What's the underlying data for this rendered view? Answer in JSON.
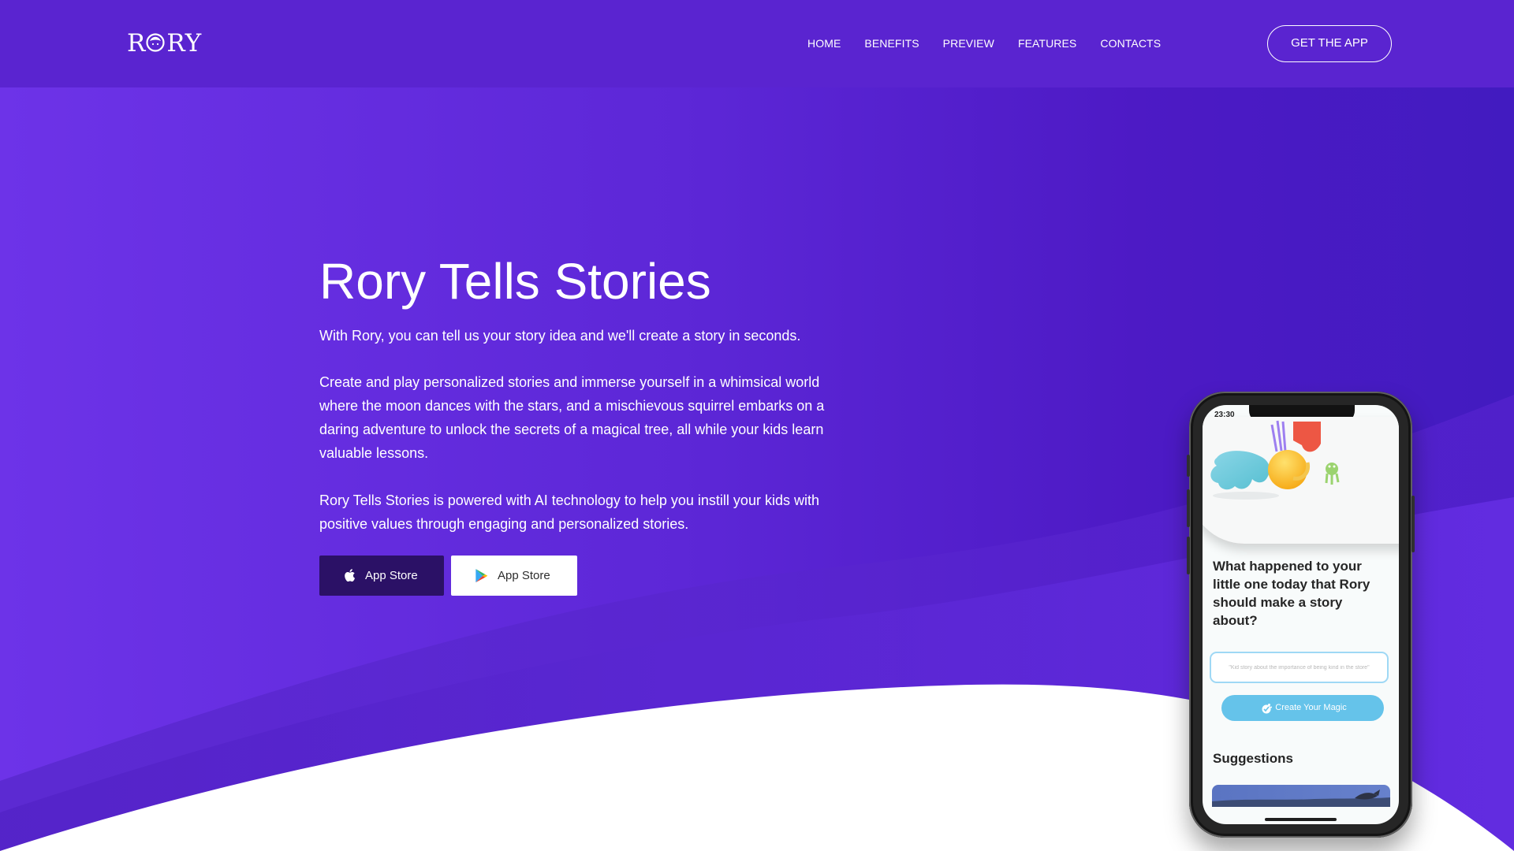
{
  "brand": {
    "logo_text": "RORY",
    "logo_icon": "rory-face-icon"
  },
  "nav": {
    "items": [
      {
        "label": "HOME"
      },
      {
        "label": "BENEFITS"
      },
      {
        "label": "PREVIEW"
      },
      {
        "label": "FEATURES"
      },
      {
        "label": "CONTACTS"
      }
    ],
    "cta_label": "GET THE APP"
  },
  "hero": {
    "title": "Rory Tells Stories",
    "subtitle": "With Rory, you can tell us your story idea and we'll create a story in seconds.",
    "paragraph_1": "Create and play personalized stories and immerse yourself in a whimsical world where the moon dances with the stars, and a mischievous squirrel embarks on a daring adventure to unlock the secrets of a magical tree, all while your kids learn valuable lessons.",
    "paragraph_2": "Rory Tells Stories is powered with AI technology to help you instill your kids with positive values through engaging and personalized stories."
  },
  "store_buttons": {
    "apple": {
      "label": "App Store",
      "icon": "apple-icon"
    },
    "google_play": {
      "label": "App Store",
      "icon": "google-play-icon"
    }
  },
  "phone": {
    "status_time": "23:30",
    "question": "What happened to your little one today that Rory should make a story about?",
    "input_placeholder": "\"Kid story about the importance of being kind in the store\"",
    "create_button_label": "Create Your Magic",
    "create_button_icon": "magic-sparkle-icon",
    "suggestions_title": "Suggestions"
  },
  "colors": {
    "header": "#5a24d0",
    "hero_start": "#6d33e8",
    "hero_end": "#421bc0",
    "apple_button": "#2b1166",
    "phone_accent": "#65c3ea"
  }
}
